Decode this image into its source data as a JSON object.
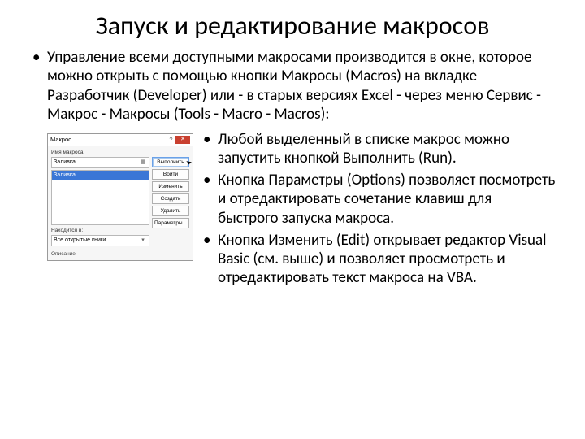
{
  "title": "Запуск и редактирование макросов",
  "intro": "Управление всеми доступными макросами производится в окне, которое можно открыть с помощью кнопки Макросы (Macros) на вкладке Разработчик (Developer) или - в старых версиях Excel - через меню Сервис - Макрос - Макросы (Tools - Macro - Macros):",
  "dialog": {
    "title": "Макрос",
    "name_label": "Имя макроса:",
    "name_value": "Заливка",
    "list_selected": "Заливка",
    "location_label": "Находится в:",
    "location_value": "Все открытые книги",
    "desc_label": "Описание",
    "buttons": {
      "run": "Выполнить",
      "step": "Войти",
      "edit": "Изменить",
      "create": "Создать",
      "delete": "Удалить",
      "options": "Параметры..."
    }
  },
  "points": [
    "Любой выделенный в списке макрос можно запустить кнопкой Выполнить (Run).",
    "Кнопка Параметры (Options) позволяет посмотреть и отредактировать сочетание клавиш для быстрого запуска макроса.",
    "Кнопка Изменить (Edit) открывает редактор Visual Basic (см. выше) и позволяет просмотреть и отредактировать текст макроса на VBA."
  ]
}
